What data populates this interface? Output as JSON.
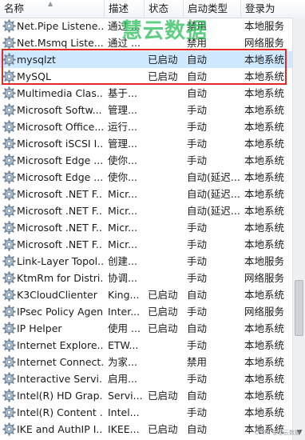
{
  "columns": {
    "name": "名称",
    "description": "描述",
    "status": "状态",
    "startup_type": "启动类型",
    "logon_as": "登录为"
  },
  "watermark": "慧云数据",
  "footer_watermark": "CSDN @慧云数据",
  "rows": [
    {
      "name": "Net.Pipe Listene...",
      "description": "通过 ...",
      "status": "",
      "startup": "禁用",
      "logon": "本地服务",
      "selected": false
    },
    {
      "name": "Net.Msmq Liste...",
      "description": "通过 ...",
      "status": "",
      "startup": "禁用",
      "logon": "网络服务",
      "selected": false
    },
    {
      "name": "mysqlzt",
      "description": "",
      "status": "已启动",
      "startup": "自动",
      "logon": "本地系统",
      "selected": true
    },
    {
      "name": "MySQL",
      "description": "",
      "status": "已启动",
      "startup": "自动",
      "logon": "本地系统",
      "selected": false
    },
    {
      "name": "Multimedia Clas...",
      "description": "基于...",
      "status": "",
      "startup": "自动",
      "logon": "本地系统",
      "selected": false
    },
    {
      "name": "Microsoft Softw...",
      "description": "管理...",
      "status": "",
      "startup": "手动",
      "logon": "本地系统",
      "selected": false
    },
    {
      "name": "Microsoft Office...",
      "description": "运行...",
      "status": "",
      "startup": "手动",
      "logon": "本地系统",
      "selected": false
    },
    {
      "name": "Microsoft iSCSI I...",
      "description": "管理...",
      "status": "",
      "startup": "手动",
      "logon": "本地系统",
      "selected": false
    },
    {
      "name": "Microsoft Edge ...",
      "description": "使你...",
      "status": "",
      "startup": "手动",
      "logon": "本地系统",
      "selected": false
    },
    {
      "name": "Microsoft Edge ...",
      "description": "使你...",
      "status": "",
      "startup": "自动(延迟...",
      "logon": "本地系统",
      "selected": false
    },
    {
      "name": "Microsoft .NET F...",
      "description": "Micr...",
      "status": "",
      "startup": "自动(延迟...",
      "logon": "本地系统",
      "selected": false
    },
    {
      "name": "Microsoft .NET F...",
      "description": "Micr...",
      "status": "",
      "startup": "自动(延迟...",
      "logon": "本地系统",
      "selected": false
    },
    {
      "name": "Microsoft .NET F...",
      "description": "Micr...",
      "status": "",
      "startup": "手动",
      "logon": "本地系统",
      "selected": false
    },
    {
      "name": "Microsoft .NET F...",
      "description": "Micr...",
      "status": "",
      "startup": "手动",
      "logon": "本地系统",
      "selected": false
    },
    {
      "name": "Link-Layer Topol...",
      "description": "创建...",
      "status": "",
      "startup": "手动",
      "logon": "本地服务",
      "selected": false
    },
    {
      "name": "KtmRm for Distri...",
      "description": "协调...",
      "status": "",
      "startup": "手动",
      "logon": "网络服务",
      "selected": false
    },
    {
      "name": "K3CloudClienter",
      "description": "King...",
      "status": "已启动",
      "startup": "自动",
      "logon": "本地系统",
      "selected": false
    },
    {
      "name": "IPsec Policy Agent",
      "description": "Inter...",
      "status": "已启动",
      "startup": "手动",
      "logon": "网络服务",
      "selected": false
    },
    {
      "name": "IP Helper",
      "description": "使用 ...",
      "status": "已启动",
      "startup": "自动",
      "logon": "本地系统",
      "selected": false
    },
    {
      "name": "Internet Explore...",
      "description": "ETW...",
      "status": "",
      "startup": "手动",
      "logon": "本地系统",
      "selected": false
    },
    {
      "name": "Internet Connect...",
      "description": "为家...",
      "status": "",
      "startup": "禁用",
      "logon": "本地系统",
      "selected": false
    },
    {
      "name": "Interactive Servi...",
      "description": "启用...",
      "status": "",
      "startup": "手动",
      "logon": "本地系统",
      "selected": false
    },
    {
      "name": "Intel(R) HD Grap...",
      "description": "Servi...",
      "status": "已启动",
      "startup": "自动",
      "logon": "本地系统",
      "selected": false
    },
    {
      "name": "Intel(R) Content ...",
      "description": "Intel...",
      "status": "",
      "startup": "手动",
      "logon": "本地系统",
      "selected": false
    },
    {
      "name": "IKE and AuthIP I...",
      "description": "IKEE...",
      "status": "已启动",
      "startup": "自动",
      "logon": "本地系统",
      "selected": false
    }
  ]
}
